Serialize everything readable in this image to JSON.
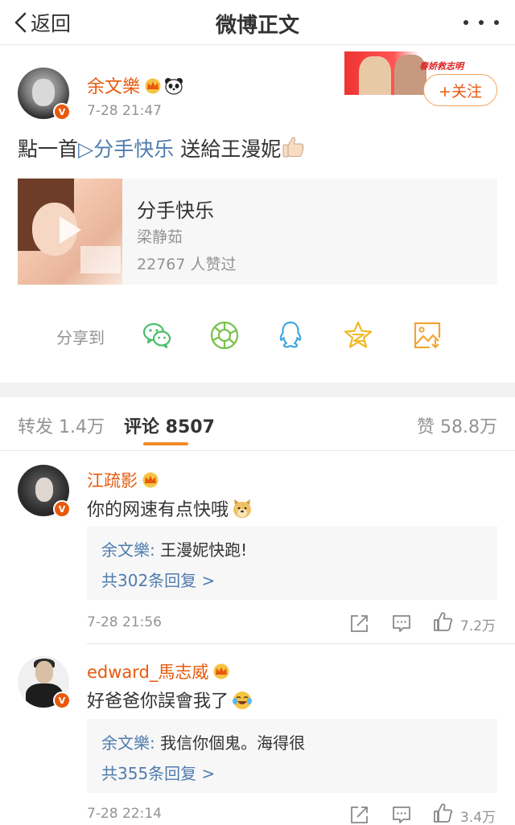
{
  "nav": {
    "back_label": "返回",
    "title": "微博正文"
  },
  "post": {
    "author": "余文樂",
    "time": "7-28 21:47",
    "follow_label": "+关注",
    "banner_text": "春娇救志明",
    "text_before": "點一首",
    "song_link": "▷分手快乐",
    "text_after": "送給王漫妮",
    "verified_badge": "V"
  },
  "music": {
    "title": "分手快乐",
    "artist": "梁静茹",
    "likes": "22767 人赞过"
  },
  "share": {
    "label": "分享到",
    "icons": [
      "wechat-icon",
      "moments-icon",
      "qq-icon",
      "qzone-icon",
      "save-image-icon"
    ]
  },
  "tabs": {
    "repost": "转发 1.4万",
    "comments": "评论 8507",
    "likes": "赞 58.8万"
  },
  "comments": [
    {
      "author": "江疏影",
      "text": "你的网速有点快哦",
      "reply_author": "余文樂:",
      "reply_text": "王漫妮快跑!",
      "reply_more": "共302条回复 >",
      "time": "7-28 21:56",
      "like_count": "7.2万"
    },
    {
      "author": "edward_馬志威",
      "text": "好爸爸你誤會我了",
      "reply_author": "余文樂:",
      "reply_text": "我信你個鬼。海得很",
      "reply_more": "共355条回复 >",
      "time": "7-28 22:14",
      "like_count": "3.4万"
    }
  ],
  "colors": {
    "accent": "#e8590c",
    "link": "#4f7cae",
    "tab_underline": "#f28c26",
    "gray_text": "#939393"
  }
}
